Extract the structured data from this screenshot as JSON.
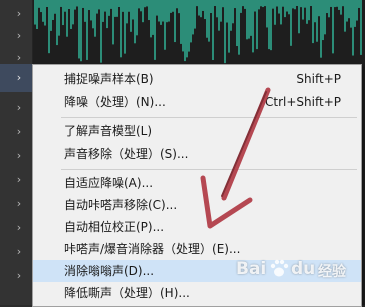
{
  "waveform_color": "#35c9a8",
  "accent_highlight": "#cfe3f7",
  "annotation_color": "#b03a45",
  "menu": {
    "items": [
      {
        "label": "捕捉噪声样本(B)",
        "shortcut": "Shift+P"
      },
      {
        "label": "降噪（处理）(N)...",
        "shortcut": "Ctrl+Shift+P"
      },
      {
        "label": "了解声音模型(L)",
        "shortcut": ""
      },
      {
        "label": "声音移除（处理）(S)...",
        "shortcut": ""
      },
      {
        "label": "自适应降噪(A)...",
        "shortcut": ""
      },
      {
        "label": "自动咔嗒声移除(C)...",
        "shortcut": ""
      },
      {
        "label": "自动相位校正(P)...",
        "shortcut": ""
      },
      {
        "label": "咔嗒声/爆音消除器（处理）(E)...",
        "shortcut": ""
      },
      {
        "label": "消除嗡嗡声(D)...",
        "shortcut": ""
      },
      {
        "label": "降低嘶声（处理）(H)...",
        "shortcut": ""
      }
    ],
    "highlighted_index": 8
  },
  "watermark": {
    "brand_left": "Bai",
    "brand_right": "du",
    "suffix": "经验"
  }
}
